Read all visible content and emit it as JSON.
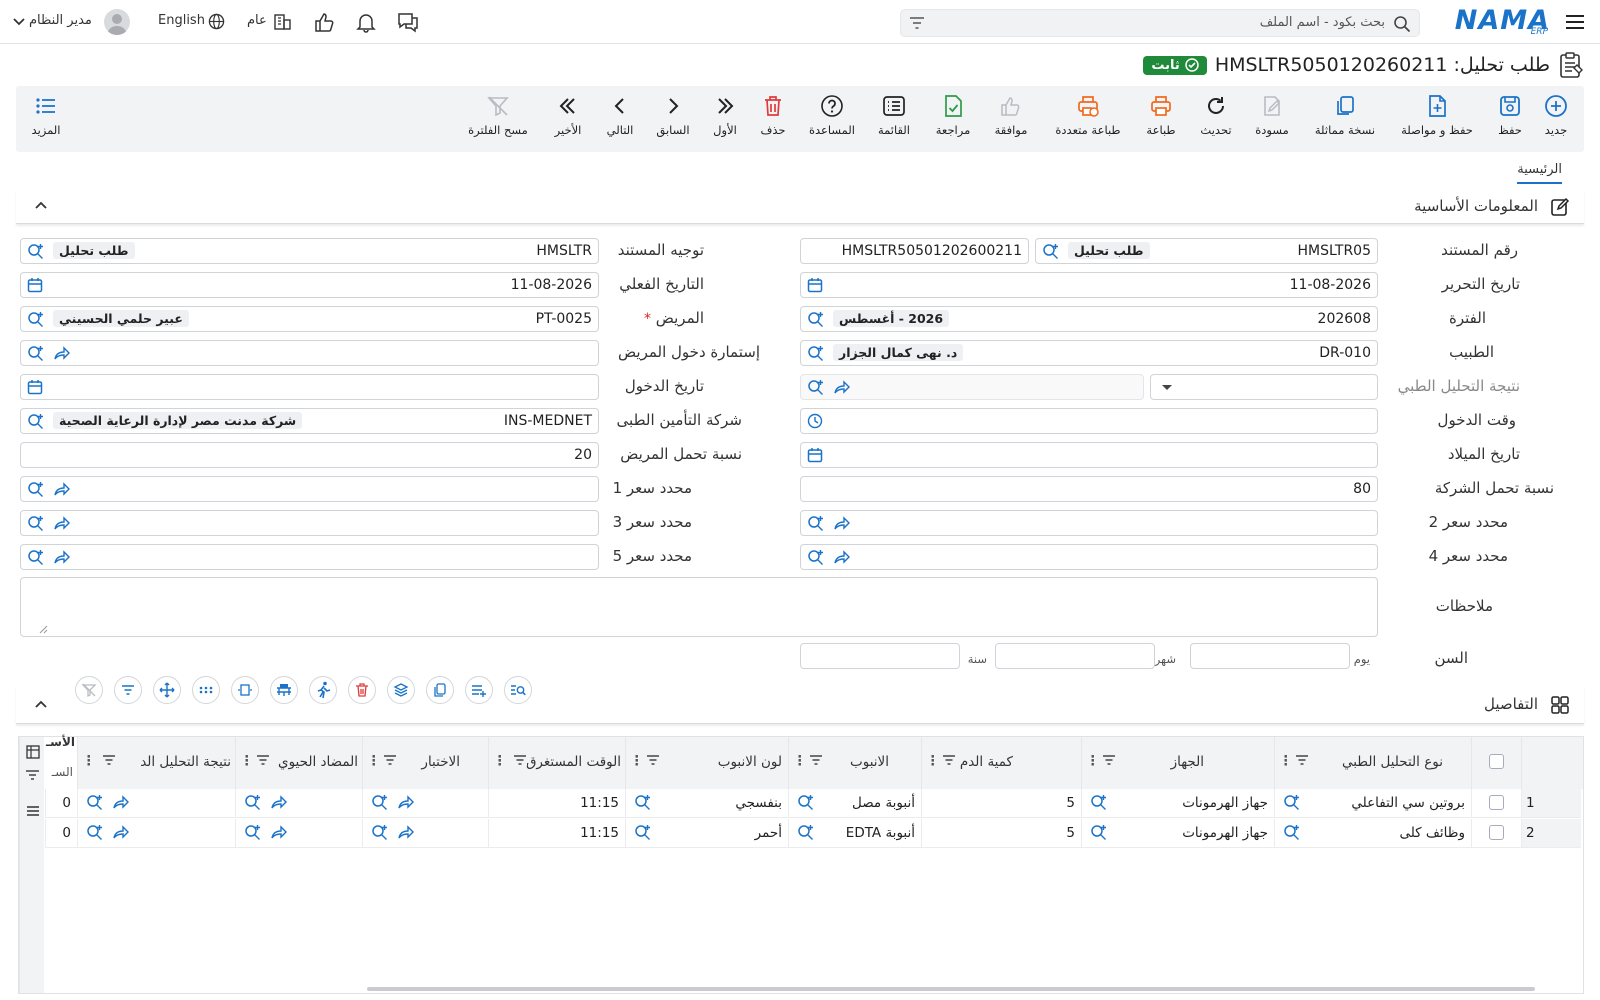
{
  "header": {
    "search_placeholder": "بحث بكود - اسم الملف",
    "language": "English",
    "scope": "عام",
    "user": "مدير النظام",
    "logo": "NAMA",
    "logo_sub": "ERP"
  },
  "title": {
    "text": "طلب تحليل: HMSLTR5050120260211",
    "status": "ثابت"
  },
  "toolbar": {
    "new": "جديد",
    "save": "حفظ",
    "save_continue": "حفظ و مواصلة",
    "duplicate": "نسخة مماثلة",
    "draft": "مسودة",
    "refresh": "تحديث",
    "print": "طباعة",
    "multi_print": "طباعة متعددة",
    "approve": "موافقة",
    "review": "مراجعة",
    "list": "القائمة",
    "help": "المساعدة",
    "delete": "حذف",
    "first": "الأول",
    "previous": "السابق",
    "next": "التالي",
    "last": "الأخير",
    "clear_filter": "مسح الفلترة",
    "more": "المزيد"
  },
  "tabs": {
    "main": "الرئيسية"
  },
  "basic_section": {
    "title": "المعلومات الأساسية"
  },
  "form": {
    "doc_number_label": "رقم المستند",
    "doc_number_code": "HMSLTR05",
    "doc_number_tag": "طلب تحليل",
    "doc_number_full": "HMSLTR50501202600211",
    "doc_direction_label": "توجيه المستند",
    "doc_direction_code": "HMSLTR",
    "doc_direction_tag": "طلب تحليل",
    "edit_date_label": "تاريخ التحرير",
    "edit_date": "11-08-2026",
    "actual_date_label": "التاريخ الفعلي",
    "actual_date": "11-08-2026",
    "period_label": "الفترة",
    "period_code": "202608",
    "period_tag": "2026 - أغسطس",
    "patient_label": "المريض",
    "patient_required": "*",
    "patient_code": "PT-0025",
    "patient_tag": "عبير حلمي الحسيني",
    "doctor_label": "الطبيب",
    "doctor_code": "DR-010",
    "doctor_tag": "د. نهى كمال الجزار",
    "admission_form_label": "إستمارة دخول المريض",
    "result_label": "نتيجة التحليل الطبي",
    "admission_date_label": "تاريخ الدخول",
    "admission_time_label": "وقت الدخول",
    "insurance_label": "شركة التأمين الطبى",
    "insurance_code": "INS-MEDNET",
    "insurance_tag": "شركة مدنت مصر لإدارة الرعاية الصحية",
    "birth_date_label": "تاريخ الميلاد",
    "patient_share_label": "نسبة تحمل المريض",
    "patient_share": "20",
    "company_share_label": "نسبة تحمل الشركة",
    "company_share": "80",
    "price1_label": "محدد سعر 1",
    "price2_label": "محدد سعر 2",
    "price3_label": "محدد سعر 3",
    "price4_label": "محدد سعر 4",
    "price5_label": "محدد سعر 5",
    "notes_label": "ملاحظات",
    "age_label": "السن",
    "day_label": "يوم",
    "month_label": "شهر",
    "year_label": "سنة"
  },
  "details_section": {
    "title": "التفاصيل"
  },
  "grid": {
    "columns": [
      "نوع التحليل الطبي",
      "الجهاز",
      "كمية الدم",
      "الانبوب",
      "لون الانبوب",
      "الوقت المستغرق",
      "الاختبار",
      "المضاد الحيوي",
      "نتيجة التحليل الد",
      "الأسـ"
    ],
    "side_label": "السـ",
    "rows": [
      {
        "n": "1",
        "type": "بروتين سي التفاعلي",
        "device": "جهاز الهرمونات",
        "qty": "5",
        "tube": "أنبوبة مصل",
        "color": "بنفسجي",
        "time": "11:15",
        "last": "0"
      },
      {
        "n": "2",
        "type": "وظائف كلى",
        "device": "جهاز الهرمونات",
        "qty": "5",
        "tube": "أنبوبة EDTA",
        "color": "أحمر",
        "time": "11:15",
        "last": "0"
      }
    ]
  },
  "colors": {
    "accent": "#1a73c9",
    "status": "#1f8a3a",
    "print": "#f06a1f",
    "delete": "#e03b3b",
    "review": "#2f9a4a"
  }
}
